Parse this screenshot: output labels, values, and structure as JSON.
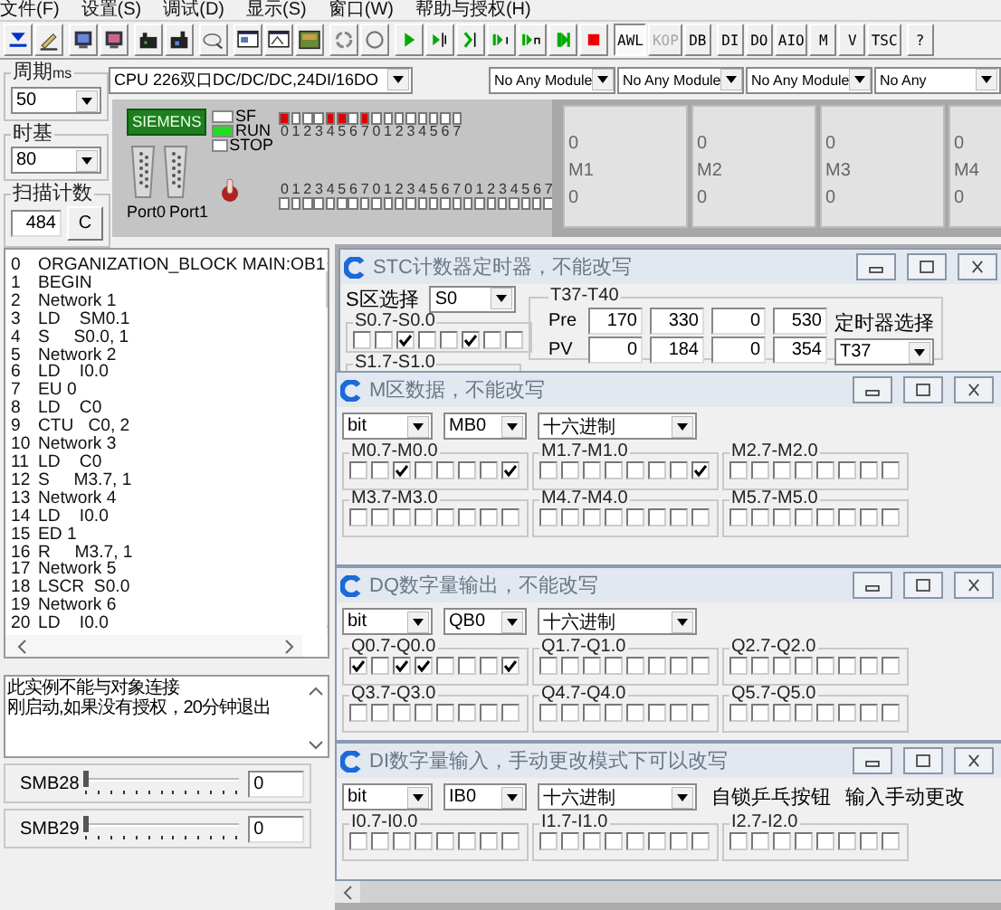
{
  "menu": [
    "文件(F)",
    "设置(S)",
    "调试(D)",
    "显示(S)",
    "窗口(W)",
    "帮助与授权(H)"
  ],
  "toolbar": {
    "buttons": [
      {
        "label": "AWL",
        "selected": true,
        "disabled": false
      },
      {
        "label": "KOP",
        "selected": false,
        "disabled": true
      },
      {
        "label": "DB",
        "selected": false,
        "disabled": false
      },
      {
        "label": "DI",
        "selected": false,
        "disabled": false
      },
      {
        "label": "DO",
        "selected": false,
        "disabled": false
      },
      {
        "label": "AIO",
        "selected": false,
        "disabled": false
      },
      {
        "label": "M",
        "selected": false,
        "disabled": false
      },
      {
        "label": "V",
        "selected": false,
        "disabled": false
      },
      {
        "label": "TSC",
        "selected": false,
        "disabled": false
      },
      {
        "label": "?",
        "selected": false,
        "disabled": false
      }
    ]
  },
  "settings": {
    "period_label": "周期",
    "period_unit": "ms",
    "period": "50",
    "timebase_label": "时基",
    "timebase": "80",
    "scan_label": "扫描计数",
    "scan_count": "484",
    "clear_button": "C"
  },
  "cpu": "CPU 226双口DC/DC/DC,24DI/16DO",
  "plc": {
    "brand": "SIEMENS",
    "ports": [
      "Port0",
      "Port1"
    ],
    "status_leds": [
      {
        "label": "SF",
        "on": false
      },
      {
        "label": "RUN",
        "on": true
      },
      {
        "label": "STOP",
        "on": false
      }
    ],
    "outputs": [
      {
        "label": "0",
        "on": true
      },
      {
        "label": "1",
        "on": false
      },
      {
        "label": "2",
        "on": false
      },
      {
        "label": "3",
        "on": false
      },
      {
        "label": "4",
        "on": true
      },
      {
        "label": "5",
        "on": true
      },
      {
        "label": "6",
        "on": false
      },
      {
        "label": "7",
        "on": true
      },
      {
        "label": "0",
        "on": false
      },
      {
        "label": "1",
        "on": false
      },
      {
        "label": "2",
        "on": false
      },
      {
        "label": "3",
        "on": false
      },
      {
        "label": "4",
        "on": false
      },
      {
        "label": "5",
        "on": false
      },
      {
        "label": "6",
        "on": false
      },
      {
        "label": "7",
        "on": false
      }
    ],
    "inputs": [
      {
        "label": "0",
        "on": false
      },
      {
        "label": "1",
        "on": false
      },
      {
        "label": "2",
        "on": false
      },
      {
        "label": "3",
        "on": false
      },
      {
        "label": "4",
        "on": false
      },
      {
        "label": "5",
        "on": false
      },
      {
        "label": "6",
        "on": false
      },
      {
        "label": "7",
        "on": false
      },
      {
        "label": "0",
        "on": false
      },
      {
        "label": "1",
        "on": false
      },
      {
        "label": "2",
        "on": false
      },
      {
        "label": "3",
        "on": false
      },
      {
        "label": "4",
        "on": false
      },
      {
        "label": "5",
        "on": false
      },
      {
        "label": "6",
        "on": false
      },
      {
        "label": "7",
        "on": false
      },
      {
        "label": "0",
        "on": false
      },
      {
        "label": "1",
        "on": false
      },
      {
        "label": "2",
        "on": false
      },
      {
        "label": "3",
        "on": false
      },
      {
        "label": "4",
        "on": false
      },
      {
        "label": "5",
        "on": false
      },
      {
        "label": "6",
        "on": false
      },
      {
        "label": "7",
        "on": false
      }
    ]
  },
  "modules": [
    {
      "name": "No Any Module",
      "lines": [
        "0",
        "M1",
        "0"
      ]
    },
    {
      "name": "No Any Module",
      "lines": [
        "0",
        "M2",
        "0"
      ]
    },
    {
      "name": "No Any Module",
      "lines": [
        "0",
        "M3",
        "0"
      ]
    },
    {
      "name": "No Any",
      "lines": [
        "0",
        "M4",
        "0"
      ]
    }
  ],
  "program": [
    {
      "num": "0",
      "text": "ORGANIZATION_BLOCK MAIN:OB1"
    },
    {
      "num": "1",
      "text": "BEGIN"
    },
    {
      "num": "2",
      "text": "Network 1"
    },
    {
      "num": "3",
      "text": "LD    SM0.1"
    },
    {
      "num": "4",
      "text": "S     S0.0, 1"
    },
    {
      "num": "5",
      "text": "Network 2"
    },
    {
      "num": "6",
      "text": "LD    I0.0"
    },
    {
      "num": "7",
      "text": "EU 0"
    },
    {
      "num": "8",
      "text": "LD    C0"
    },
    {
      "num": "9",
      "text": "CTU   C0, 2"
    },
    {
      "num": "10",
      "text": "Network 3"
    },
    {
      "num": "11",
      "text": "LD    C0"
    },
    {
      "num": "12",
      "text": "S     M3.7, 1"
    },
    {
      "num": "13",
      "text": "Network 4"
    },
    {
      "num": "14",
      "text": "LD    I0.0"
    },
    {
      "num": "15",
      "text": "ED 1"
    },
    {
      "num": "16",
      "text": "R     M3.7, 1"
    },
    {
      "num": "17",
      "text": "Network 5"
    },
    {
      "num": "18",
      "text": "LSCR  S0.0"
    },
    {
      "num": "19",
      "text": "Network 6"
    },
    {
      "num": "20",
      "text": "LD    I0.0"
    }
  ],
  "messages": [
    "此实例不能与对象连接",
    "刚启动,如果没有授权，20分钟退出"
  ],
  "sliders": [
    {
      "label": "SMB28",
      "level": 0,
      "value": "0"
    },
    {
      "label": "SMB29",
      "level": 0,
      "value": "0"
    }
  ],
  "windows": [
    {
      "kind": "timers",
      "title": "STC计数器定时器，不能改写",
      "area_label": "S区选择",
      "area": "S0",
      "groups": [
        {
          "label": "S0.7-S0.0",
          "checked": [
            false,
            false,
            true,
            false,
            false,
            true,
            false,
            false
          ]
        },
        {
          "label": "S1.7-S1.0"
        }
      ],
      "timers": {
        "label": "T37-T40",
        "rows": [
          {
            "label": "Pre",
            "values": [
              "170",
              "330",
              "0",
              "530"
            ]
          },
          {
            "label": "PV",
            "values": [
              "0",
              "184",
              "0",
              "354"
            ]
          }
        ],
        "select_label": "定时器选择",
        "select": "T37"
      }
    },
    {
      "kind": "bits",
      "title": "M区数据，不能改写",
      "selects": [
        "bit",
        "MB0",
        "十六进制"
      ],
      "groups": [
        {
          "label": "M0.7-M0.0",
          "checked": [
            false,
            false,
            true,
            false,
            false,
            false,
            false,
            true
          ]
        },
        {
          "label": "M1.7-M1.0",
          "checked": [
            false,
            false,
            false,
            false,
            false,
            false,
            false,
            true
          ]
        },
        {
          "label": "M2.7-M2.0",
          "checked": [
            false,
            false,
            false,
            false,
            false,
            false,
            false,
            false
          ]
        },
        {
          "label": "M3.7-M3.0",
          "checked": [
            false,
            false,
            false,
            false,
            false,
            false,
            false,
            false
          ]
        },
        {
          "label": "M4.7-M4.0",
          "checked": [
            false,
            false,
            false,
            false,
            false,
            false,
            false,
            false
          ]
        },
        {
          "label": "M5.7-M5.0",
          "checked": [
            false,
            false,
            false,
            false,
            false,
            false,
            false,
            false
          ]
        }
      ]
    },
    {
      "kind": "bits",
      "title": "DQ数字量输出，不能改写",
      "selects": [
        "bit",
        "QB0",
        "十六进制"
      ],
      "groups": [
        {
          "label": "Q0.7-Q0.0",
          "checked": [
            true,
            false,
            true,
            true,
            false,
            false,
            false,
            true
          ]
        },
        {
          "label": "Q1.7-Q1.0",
          "checked": [
            false,
            false,
            false,
            false,
            false,
            false,
            false,
            false
          ]
        },
        {
          "label": "Q2.7-Q2.0",
          "checked": [
            false,
            false,
            false,
            false,
            false,
            false,
            false,
            false
          ]
        },
        {
          "label": "Q3.7-Q3.0",
          "checked": [
            false,
            false,
            false,
            false,
            false,
            false,
            false,
            false
          ]
        },
        {
          "label": "Q4.7-Q4.0",
          "checked": [
            false,
            false,
            false,
            false,
            false,
            false,
            false,
            false
          ]
        },
        {
          "label": "Q5.7-Q5.0",
          "checked": [
            false,
            false,
            false,
            false,
            false,
            false,
            false,
            false
          ]
        }
      ]
    },
    {
      "kind": "bits",
      "title": "DI数字量输入，手动更改模式下可以改写",
      "selects": [
        "bit",
        "IB0",
        "十六进制"
      ],
      "notes": [
        "自锁乒乓按钮",
        "输入手动更改"
      ],
      "groups": [
        {
          "label": "I0.7-I0.0",
          "checked": [
            false,
            false,
            false,
            false,
            false,
            false,
            false,
            false
          ]
        },
        {
          "label": "I1.7-I1.0",
          "checked": [
            false,
            false,
            false,
            false,
            false,
            false,
            false,
            false
          ]
        },
        {
          "label": "I2.7-I2.0",
          "checked": [
            false,
            false,
            false,
            false,
            false,
            false,
            false,
            false
          ]
        }
      ]
    }
  ]
}
